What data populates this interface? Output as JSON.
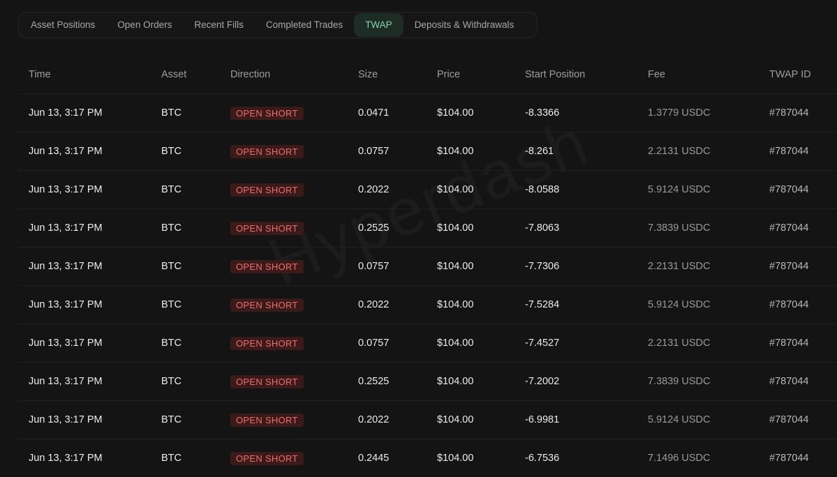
{
  "tabs": [
    {
      "label": "Asset Positions"
    },
    {
      "label": "Open Orders"
    },
    {
      "label": "Recent Fills"
    },
    {
      "label": "Completed Trades"
    },
    {
      "label": "TWAP",
      "active": true
    },
    {
      "label": "Deposits & Withdrawals"
    }
  ],
  "watermark": "Hyperdash",
  "columns": [
    "Time",
    "Asset",
    "Direction",
    "Size",
    "Price",
    "Start Position",
    "Fee",
    "TWAP ID"
  ],
  "rows": [
    {
      "time": "Jun 13, 3:17 PM",
      "asset": "BTC",
      "direction": "OPEN SHORT",
      "size": "0.0471",
      "price": "$104.00",
      "start_position": "-8.3366",
      "fee": "1.3779 USDC",
      "twap_id": "#787044"
    },
    {
      "time": "Jun 13, 3:17 PM",
      "asset": "BTC",
      "direction": "OPEN SHORT",
      "size": "0.0757",
      "price": "$104.00",
      "start_position": "-8.261",
      "fee": "2.2131 USDC",
      "twap_id": "#787044"
    },
    {
      "time": "Jun 13, 3:17 PM",
      "asset": "BTC",
      "direction": "OPEN SHORT",
      "size": "0.2022",
      "price": "$104.00",
      "start_position": "-8.0588",
      "fee": "5.9124 USDC",
      "twap_id": "#787044"
    },
    {
      "time": "Jun 13, 3:17 PM",
      "asset": "BTC",
      "direction": "OPEN SHORT",
      "size": "0.2525",
      "price": "$104.00",
      "start_position": "-7.8063",
      "fee": "7.3839 USDC",
      "twap_id": "#787044"
    },
    {
      "time": "Jun 13, 3:17 PM",
      "asset": "BTC",
      "direction": "OPEN SHORT",
      "size": "0.0757",
      "price": "$104.00",
      "start_position": "-7.7306",
      "fee": "2.2131 USDC",
      "twap_id": "#787044"
    },
    {
      "time": "Jun 13, 3:17 PM",
      "asset": "BTC",
      "direction": "OPEN SHORT",
      "size": "0.2022",
      "price": "$104.00",
      "start_position": "-7.5284",
      "fee": "5.9124 USDC",
      "twap_id": "#787044"
    },
    {
      "time": "Jun 13, 3:17 PM",
      "asset": "BTC",
      "direction": "OPEN SHORT",
      "size": "0.0757",
      "price": "$104.00",
      "start_position": "-7.4527",
      "fee": "2.2131 USDC",
      "twap_id": "#787044"
    },
    {
      "time": "Jun 13, 3:17 PM",
      "asset": "BTC",
      "direction": "OPEN SHORT",
      "size": "0.2525",
      "price": "$104.00",
      "start_position": "-7.2002",
      "fee": "7.3839 USDC",
      "twap_id": "#787044"
    },
    {
      "time": "Jun 13, 3:17 PM",
      "asset": "BTC",
      "direction": "OPEN SHORT",
      "size": "0.2022",
      "price": "$104.00",
      "start_position": "-6.9981",
      "fee": "5.9124 USDC",
      "twap_id": "#787044"
    },
    {
      "time": "Jun 13, 3:17 PM",
      "asset": "BTC",
      "direction": "OPEN SHORT",
      "size": "0.2445",
      "price": "$104.00",
      "start_position": "-6.7536",
      "fee": "7.1496 USDC",
      "twap_id": "#787044"
    }
  ],
  "colors": {
    "background": "#141414",
    "active_tab_bg": "#1d2d26",
    "active_tab_text": "#86d3ae",
    "short_badge_bg": "#3b1a1a",
    "short_badge_text": "#ef6d6d"
  }
}
